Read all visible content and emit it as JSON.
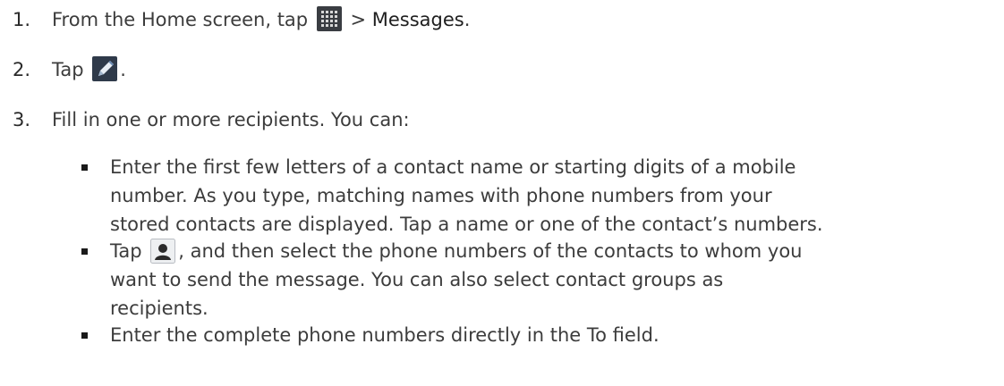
{
  "steps": [
    {
      "number": "1.",
      "text_before": "From the Home screen, tap",
      "icon": "apps-grid-icon",
      "text_after": " > ",
      "emphasis": "Messages",
      "trailing": "."
    },
    {
      "number": "2.",
      "text_before": "Tap",
      "icon": "compose-pencil-icon",
      "trailing": "."
    },
    {
      "number": "3.",
      "text": "Fill in one or more recipients. You can:"
    }
  ],
  "bullets": [
    {
      "lines": [
        "Enter the first few letters of a contact name or starting digits of a mobile",
        "number. As you type, matching names with phone numbers from your",
        "stored contacts are displayed. Tap a name or one of the contact’s numbers."
      ]
    },
    {
      "first_before": "Tap",
      "icon": "contact-person-icon",
      "first_after": ", and then select the phone numbers of the contacts to whom you",
      "lines": [
        "want to send the message. You can also select contact groups as",
        "recipients."
      ]
    },
    {
      "lines": [
        "Enter the complete phone numbers directly in the To field."
      ]
    }
  ]
}
